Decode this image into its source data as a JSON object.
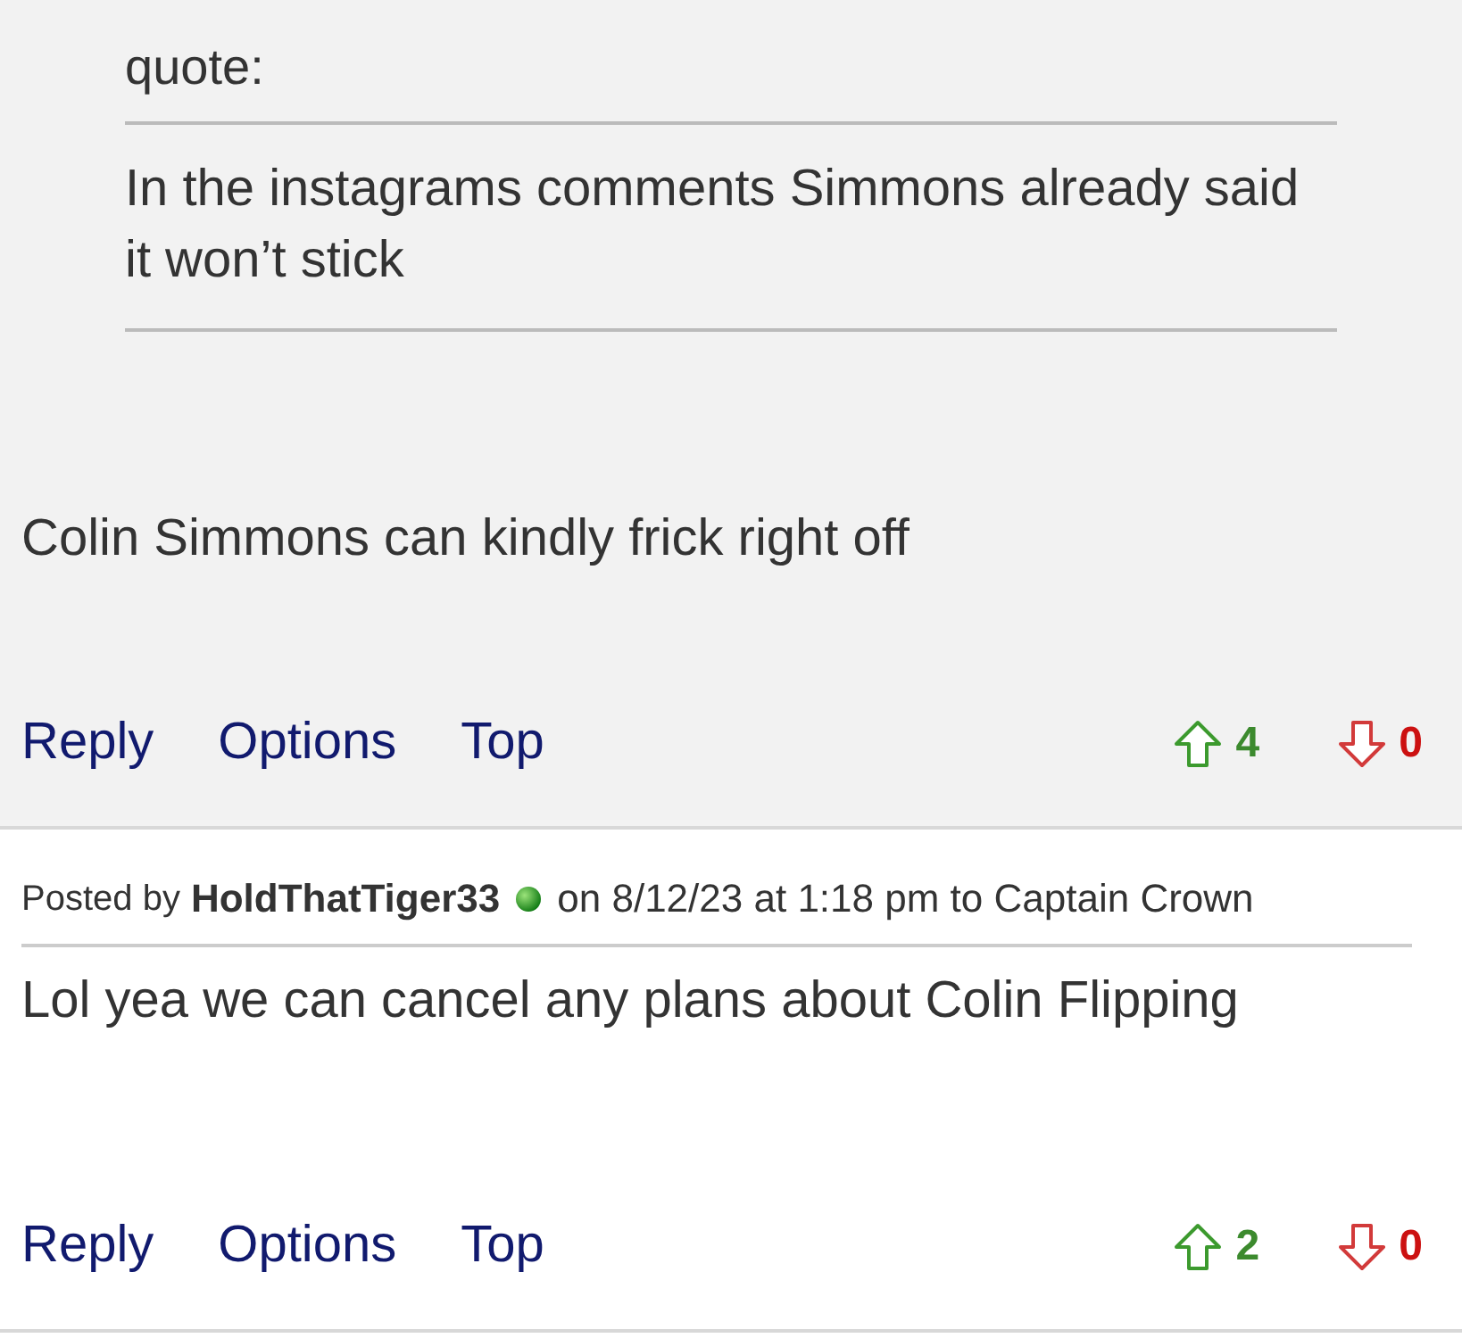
{
  "posts": [
    {
      "quote": {
        "label": "quote:",
        "text": "In the instagrams comments Simmons already said it won’t stick"
      },
      "body": "Colin Simmons can kindly frick right off",
      "actions": [
        "Reply",
        "Options",
        "Top"
      ],
      "upvotes": "4",
      "downvotes": "0"
    },
    {
      "header": {
        "prefix": "Posted by",
        "author": "HoldThatTiger33",
        "suffix": "on 8/12/23 at 1:18 pm to Captain Crown"
      },
      "body": "Lol yea we can cancel any plans about Colin Flipping",
      "actions": [
        "Reply",
        "Options",
        "Top"
      ],
      "upvotes": "2",
      "downvotes": "0"
    }
  ]
}
